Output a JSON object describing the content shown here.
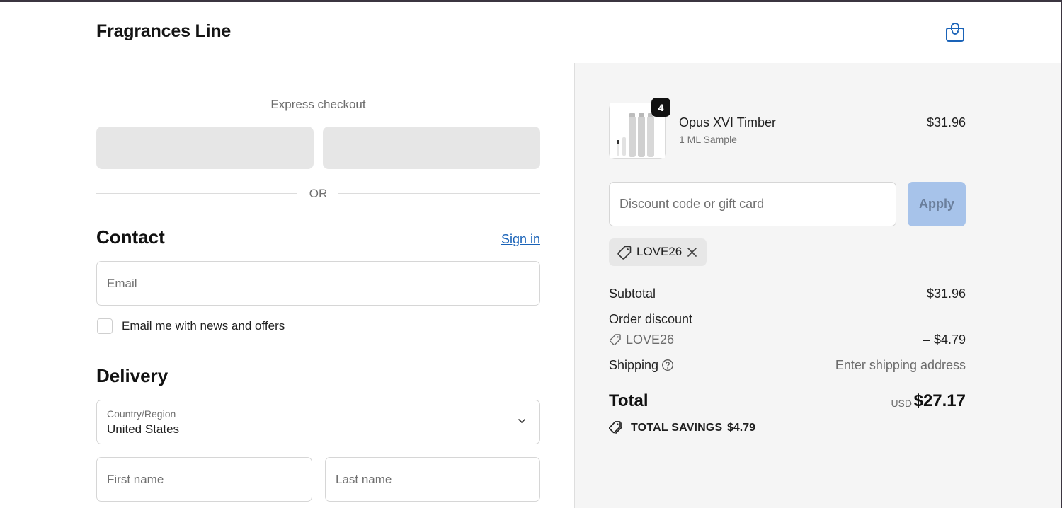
{
  "header": {
    "brand": "Fragrances Line",
    "cart_icon": "shopping-bag-icon"
  },
  "express": {
    "title": "Express checkout",
    "or_label": "OR"
  },
  "contact": {
    "heading": "Contact",
    "sign_in_label": "Sign in",
    "email_placeholder": "Email",
    "newsletter_label": "Email me with news and offers",
    "newsletter_checked": false
  },
  "delivery": {
    "heading": "Delivery",
    "country_label": "Country/Region",
    "country_value": "United States",
    "first_name_placeholder": "First name",
    "last_name_placeholder": "Last name"
  },
  "summary": {
    "item": {
      "quantity": "4",
      "name": "Opus XVI Timber",
      "variant": "1 ML Sample",
      "price": "$31.96"
    },
    "discount_placeholder": "Discount code or gift card",
    "apply_label": "Apply",
    "applied_code": "LOVE26",
    "subtotal_label": "Subtotal",
    "subtotal_value": "$31.96",
    "order_discount_label": "Order discount",
    "order_discount_code": "LOVE26",
    "order_discount_value": "– $4.79",
    "shipping_label": "Shipping",
    "shipping_value": "Enter shipping address",
    "total_label": "Total",
    "currency": "USD",
    "total_value": "$27.17",
    "savings_label": "TOTAL SAVINGS",
    "savings_value": "$4.79"
  },
  "colors": {
    "accent_link": "#1a63b8",
    "apply_disabled": "#a7c3ea",
    "summary_bg": "#f5f5f5"
  }
}
